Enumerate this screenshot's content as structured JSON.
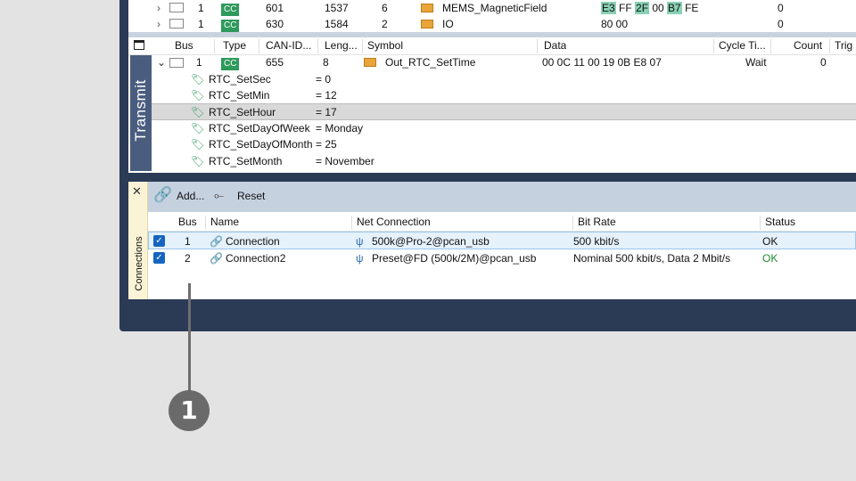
{
  "top_rows": [
    {
      "bus": "1",
      "type": "CC",
      "id": "601",
      "len": "1537",
      "dlc": "6",
      "symbol": "MEMS_MagneticField",
      "data": "E3 FF 2F 00 B7 FE",
      "count": "0"
    },
    {
      "bus": "1",
      "type": "CC",
      "id": "630",
      "len": "1584",
      "dlc": "2",
      "symbol": "IO",
      "data": "80 00",
      "count": "0"
    }
  ],
  "transmit": {
    "tab_label": "Transmit",
    "headers": {
      "bus": "Bus",
      "type": "Type",
      "canid": "CAN-ID...",
      "length": "Leng...",
      "symbol": "Symbol",
      "data": "Data",
      "cycle": "Cycle Ti...",
      "count": "Count",
      "trigger": "Trig"
    },
    "message": {
      "bus": "1",
      "type": "CC",
      "canid": "655",
      "length": "8",
      "symbol": "Out_RTC_SetTime",
      "data": "00 0C 11 00 19 0B E8 07",
      "cycle": "Wait",
      "count": "0"
    },
    "signals": [
      {
        "name": "RTC_SetSec",
        "value": "= 0"
      },
      {
        "name": "RTC_SetMin",
        "value": "= 12"
      },
      {
        "name": "RTC_SetHour",
        "value": "= 17"
      },
      {
        "name": "RTC_SetDayOfWeek",
        "value": "= Monday"
      },
      {
        "name": "RTC_SetDayOfMonth",
        "value": "= 25"
      },
      {
        "name": "RTC_SetMonth",
        "value": "= November"
      }
    ]
  },
  "connections": {
    "tab_label": "Connections",
    "toolbar": {
      "add": "Add...",
      "reset": "Reset"
    },
    "headers": {
      "bus": "Bus",
      "name": "Name",
      "net": "Net Connection",
      "bitrate": "Bit Rate",
      "status": "Status"
    },
    "rows": [
      {
        "bus": "1",
        "name": "Connection",
        "net": "500k@Pro-2@pcan_usb",
        "bitrate": "500 kbit/s",
        "status": "OK"
      },
      {
        "bus": "2",
        "name": "Connection2",
        "net": "Preset@FD (500k/2M)@pcan_usb",
        "bitrate": "Nominal 500 kbit/s, Data 2 Mbit/s",
        "status": "OK"
      }
    ]
  },
  "callout": {
    "number": "1"
  },
  "colors": {
    "accent_green": "#2e9a5c",
    "status_ok_green": "#1e8a2e",
    "frame": "#2b3a55",
    "toolbar": "#c6d1e0"
  }
}
